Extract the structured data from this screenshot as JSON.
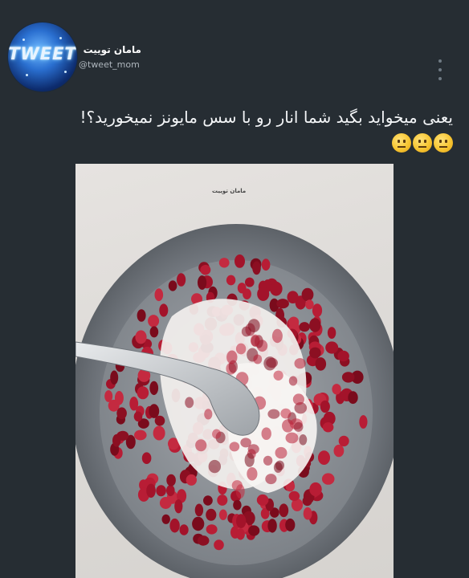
{
  "tweet": {
    "author_name": "مامان توییت",
    "author_handle": "@tweet_mom",
    "avatar_text": "TWEET",
    "text": "یعنی میخواید بگید شما انار رو با سس مایونز نمیخورید؟!",
    "emojis": [
      "neutral-face",
      "neutral-face",
      "neutral-face"
    ]
  },
  "photo": {
    "watermark": "مامان توییت",
    "subject": "pomegranate-seeds-with-mayonnaise-in-grey-bowl"
  },
  "colors": {
    "background": "#262d33",
    "text": "#f3f5f7",
    "handle": "#aeb6bd"
  }
}
